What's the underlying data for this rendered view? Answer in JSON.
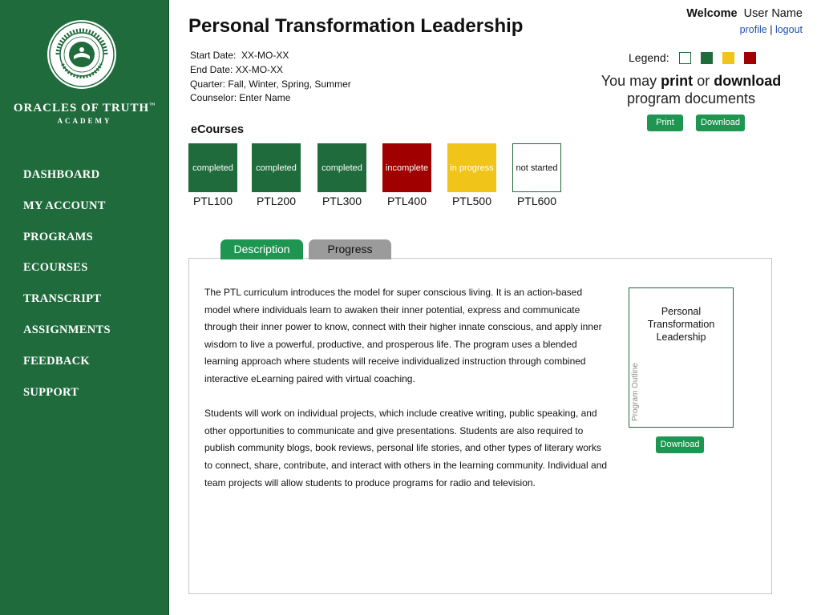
{
  "brand": {
    "name": "ORACLES OF TRUTH",
    "tm": "™",
    "sub": "ACADEMY"
  },
  "nav": [
    "DASHBOARD",
    "MY ACCOUNT",
    "PROGRAMS",
    "ECOURSES",
    "TRANSCRIPT",
    "ASSIGNMENTS",
    "FEEDBACK",
    "SUPPORT"
  ],
  "header": {
    "title": "Personal Transformation Leadership",
    "welcome_label": "Welcome",
    "user_name": "User Name",
    "profile_link": "profile",
    "separator": "|",
    "logout_link": "logout"
  },
  "meta": {
    "start_label": "Start Date:",
    "start_value": "XX-MO-XX",
    "end_label": "End Date:",
    "end_value": "XX-MO-XX",
    "quarter_label": "Quarter:",
    "quarter_value": "Fall, Winter, Spring, Summer",
    "counselor_label": "Counselor:",
    "counselor_value": "Enter Name"
  },
  "legend": {
    "label": "Legend:",
    "colors": {
      "not_started": "#ffffff",
      "completed": "#1f6b3c",
      "in_progress": "#f0c419",
      "incomplete": "#a10000"
    }
  },
  "print_section": {
    "line1_pre": "You may",
    "line1_print": "print",
    "line1_mid": "or",
    "line1_download": "download",
    "line2": "program documents",
    "print_button": "Print",
    "download_button": "Download"
  },
  "ecourses": {
    "title": "eCourses",
    "items": [
      {
        "status": "completed",
        "code": "PTL100"
      },
      {
        "status": "completed",
        "code": "PTL200"
      },
      {
        "status": "completed",
        "code": "PTL300"
      },
      {
        "status": "incomplete",
        "code": "PTL400"
      },
      {
        "status": "in progress",
        "code": "PTL500"
      },
      {
        "status": "not started",
        "code": "PTL600"
      }
    ]
  },
  "tabs": {
    "description": "Description",
    "progress": "Progress"
  },
  "description": {
    "p1": "The PTL curriculum introduces the model for super conscious living. It is an action-based model where individuals learn to awaken their inner potential, express and communicate through their inner power to know, connect with their higher innate conscious, and apply inner wisdom to live a powerful, productive, and prosperous life. The program uses a blended learning approach where students will receive individualized instruction through combined interactive eLearning paired with virtual coaching.",
    "p2": "Students will work on individual projects, which include creative writing, public speaking, and other opportunities to communicate and give presentations. Students are also required to publish community blogs, book reviews, personal life stories, and other types of literary works to connect, share, contribute, and interact with others in the learning community. Individual and team projects will allow students to produce programs for radio and television."
  },
  "outline": {
    "title": "Personal Transformation Leadership",
    "side_label": "Program Outline",
    "download_button": "Download"
  }
}
